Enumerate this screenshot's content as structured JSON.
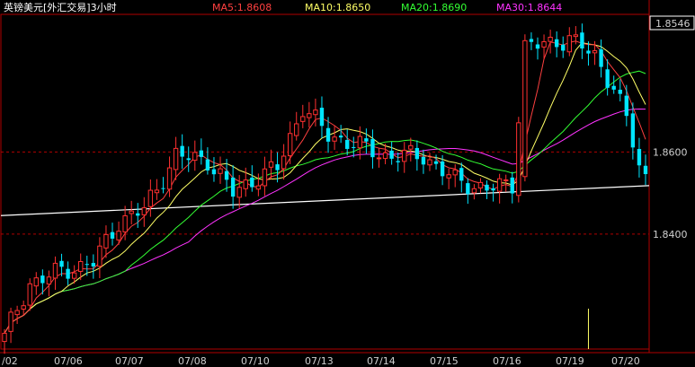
{
  "header": {
    "title": "英镑美元[外汇交易]3小时",
    "ma": [
      {
        "label": "MA5:1.8608",
        "color": "#ff4040"
      },
      {
        "label": "MA10:1.8650",
        "color": "#ffff66"
      },
      {
        "label": "MA20:1.8690",
        "color": "#33ff33"
      },
      {
        "label": "MA30:1.8644",
        "color": "#ff33ff"
      }
    ]
  },
  "chart_data": {
    "type": "candlestick",
    "ylim": [
      1.812,
      1.8935
    ],
    "y_ticks": [
      {
        "value": 1.84,
        "label": "1.8400"
      },
      {
        "value": 1.86,
        "label": "1.8600"
      }
    ],
    "last_price": {
      "value": 1.8546,
      "label": "1.8546"
    },
    "x_labels": [
      "/02",
      "07/06",
      "07/07",
      "07/08",
      "07/10",
      "07/13",
      "07/14",
      "07/15",
      "07/16",
      "07/19",
      "07/20"
    ],
    "trendline": {
      "start": 1.8445,
      "end": 1.8518
    },
    "colors": {
      "up": "#ff3030",
      "down": "#00e5ff",
      "grid": "#b00000",
      "trend": "#ffffff",
      "volume": "#ffff66"
    },
    "ma_colors": {
      "ma5": "#ff4040",
      "ma10": "#ffff66",
      "ma20": "#33ff33",
      "ma30": "#ff33ff"
    },
    "volume_spike": {
      "candle": 92,
      "fraction": 0.9
    }
  }
}
